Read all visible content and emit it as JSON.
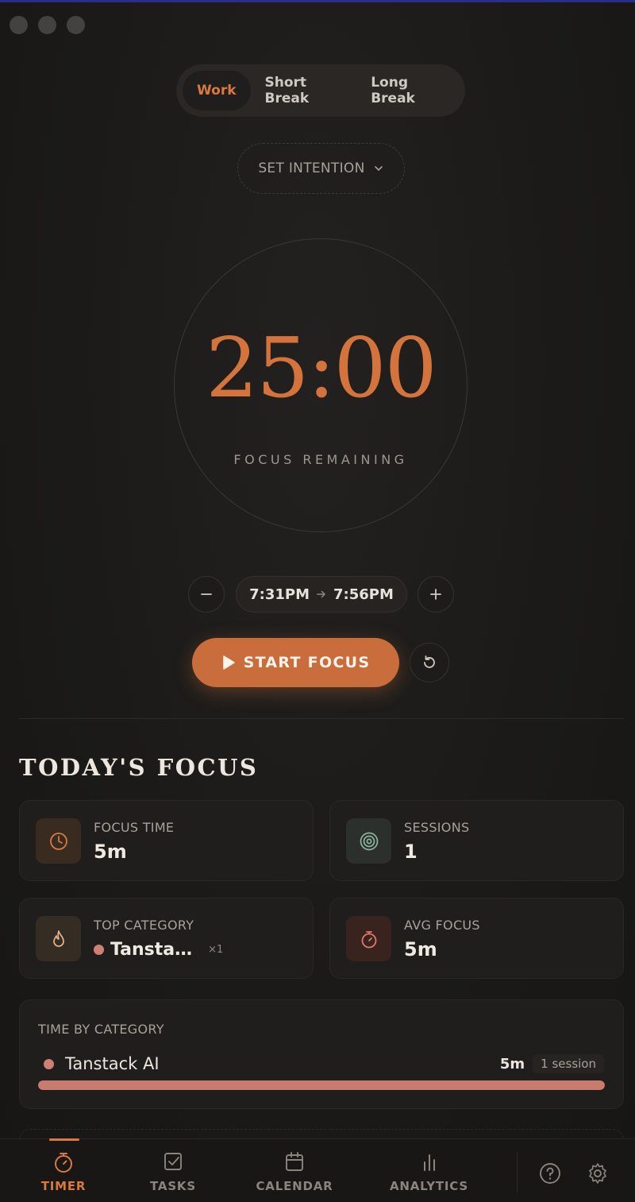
{
  "mode_tabs": {
    "work": "Work",
    "short_break": "Short Break",
    "long_break": "Long Break",
    "active": "work"
  },
  "intention": {
    "label": "SET INTENTION"
  },
  "timer": {
    "time": "25:00",
    "label": "FOCUS REMAINING",
    "start_time": "7:31PM",
    "end_time": "7:56PM",
    "start_button": "START FOCUS"
  },
  "today": {
    "title": "TODAY'S FOCUS",
    "focus_time": {
      "label": "FOCUS TIME",
      "value": "5m"
    },
    "sessions": {
      "label": "SESSIONS",
      "value": "1"
    },
    "top_category": {
      "label": "TOP CATEGORY",
      "value": "Tansta…",
      "count": "×1"
    },
    "avg_focus": {
      "label": "AVG FOCUS",
      "value": "5m"
    }
  },
  "time_by_category": {
    "title": "TIME BY CATEGORY",
    "rows": [
      {
        "name": "Tanstack AI",
        "duration": "5m",
        "sessions": "1 session",
        "fraction": 1.0,
        "color": "#c97b6e"
      }
    ]
  },
  "nav": {
    "timer": "TIMER",
    "tasks": "TASKS",
    "calendar": "CALENDAR",
    "analytics": "ANALYTICS"
  },
  "colors": {
    "accent": "#d9793f",
    "category_dot": "#cf7f74"
  }
}
